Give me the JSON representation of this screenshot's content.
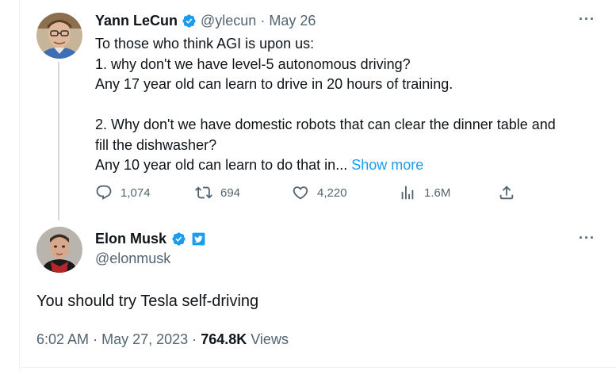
{
  "parent_tweet": {
    "author_name": "Yann LeCun",
    "handle": "@ylecun",
    "separator": "·",
    "date": "May 26",
    "more_icon": "···",
    "lines": [
      "To those who think AGI is upon us:",
      "1. why don't we have level-5 autonomous driving?",
      "Any 17 year old can learn to drive in 20 hours of training.",
      "",
      "2. Why don't we have domestic robots that can clear the dinner table and",
      "fill the dishwasher?"
    ],
    "last_line": "Any 10 year old can learn to do that in...",
    "show_more": "Show more",
    "actions": {
      "replies": "1,074",
      "retweets": "694",
      "likes": "4,220",
      "views": "1.6M"
    }
  },
  "reply_tweet": {
    "author_name": "Elon Musk",
    "handle": "@elonmusk",
    "more_icon": "···",
    "text": "You should try Tesla self-driving",
    "timestamp": "6:02 AM",
    "date": "May 27, 2023",
    "separator": "·",
    "views_count": "764.8K",
    "views_label": "Views"
  },
  "colors": {
    "verified_blue": "#1d9bf0",
    "secondary_text": "#536471",
    "primary_text": "#0f1419",
    "thread_line": "#cfd9de"
  }
}
